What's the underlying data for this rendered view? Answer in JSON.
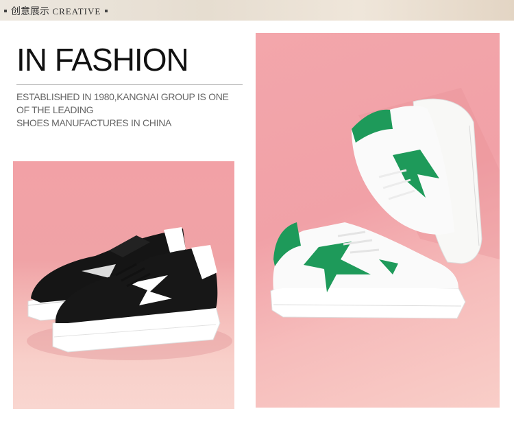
{
  "header": {
    "title_cn": "创意展示",
    "title_en": "CREATIVE"
  },
  "headline": "IN FASHION",
  "tagline": [
    "ESTABLISHED IN 1980,KANGNAI GROUP IS ONE",
    "OF THE LEADING",
    "SHOES MANUFACTURES IN  CHINA"
  ],
  "colors": {
    "background_pink": "#f1a1a7",
    "accent_green": "#1e9a5a",
    "shoe_black": "#1a1a1a",
    "shoe_white": "#f7f7f5"
  }
}
